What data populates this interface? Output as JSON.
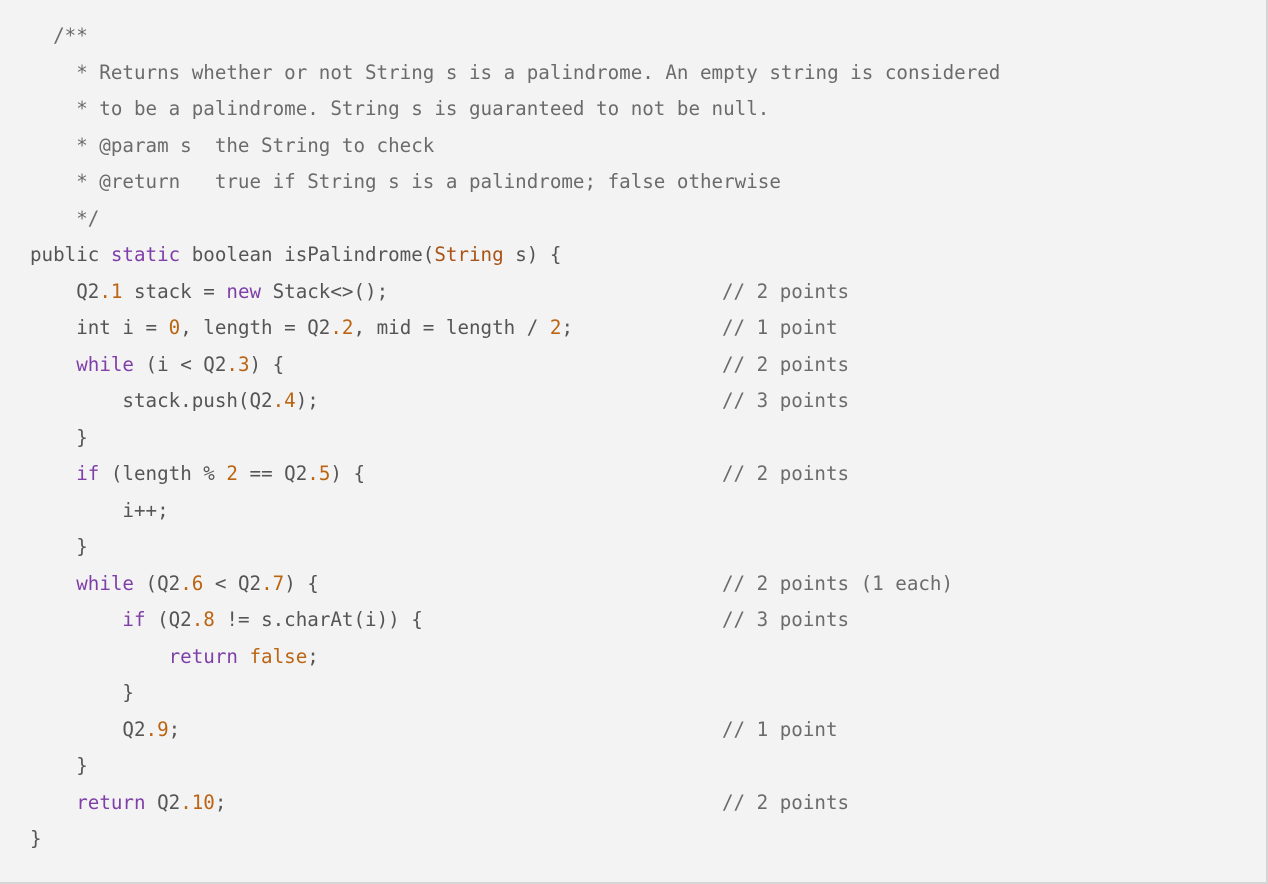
{
  "editor": {
    "language": "java",
    "background_color": "#f3f3f3",
    "border_color": "#d5d5d5",
    "colors": {
      "plain": "#555555",
      "comment": "#6b6b6b",
      "keyword": "#7f3fa8",
      "type": "#a85418",
      "number": "#bb6412",
      "literal": "#bb6412"
    }
  },
  "code": {
    "title": "isPalindrome",
    "lines": [
      {
        "n": 1,
        "indent": 2,
        "text": "/**"
      },
      {
        "n": 2,
        "indent": 4,
        "text": "* Returns whether or not String s is a palindrome. An empty string is considered"
      },
      {
        "n": 3,
        "indent": 4,
        "text": "* to be a palindrome. String s is guaranteed to not be null."
      },
      {
        "n": 4,
        "indent": 4,
        "text": "* @param s  the String to check"
      },
      {
        "n": 5,
        "indent": 4,
        "text": "* @return   true if String s is a palindrome; false otherwise"
      },
      {
        "n": 6,
        "indent": 4,
        "text": "*/"
      },
      {
        "n": 7,
        "indent": 0,
        "text": "public static boolean isPalindrome(String s) {"
      },
      {
        "n": 8,
        "indent": 4,
        "text": "Q2.1 stack = new Stack<>();",
        "comment": "// 2 points"
      },
      {
        "n": 9,
        "indent": 4,
        "text": "int i = 0, length = Q2.2, mid = length / 2;",
        "comment": "// 1 point"
      },
      {
        "n": 10,
        "indent": 4,
        "text": "while (i < Q2.3) {",
        "comment": "// 2 points"
      },
      {
        "n": 11,
        "indent": 8,
        "text": "stack.push(Q2.4);",
        "comment": "// 3 points"
      },
      {
        "n": 12,
        "indent": 4,
        "text": "}"
      },
      {
        "n": 13,
        "indent": 4,
        "text": "if (length % 2 == Q2.5) {",
        "comment": "// 2 points"
      },
      {
        "n": 14,
        "indent": 8,
        "text": "i++;"
      },
      {
        "n": 15,
        "indent": 4,
        "text": "}"
      },
      {
        "n": 16,
        "indent": 4,
        "text": "while (Q2.6 < Q2.7) {",
        "comment": "// 2 points (1 each)"
      },
      {
        "n": 17,
        "indent": 8,
        "text": "if (Q2.8 != s.charAt(i)) {",
        "comment": "// 3 points"
      },
      {
        "n": 18,
        "indent": 12,
        "text": "return false;"
      },
      {
        "n": 19,
        "indent": 8,
        "text": "}"
      },
      {
        "n": 20,
        "indent": 8,
        "text": "Q2.9;",
        "comment": "// 1 point"
      },
      {
        "n": 21,
        "indent": 4,
        "text": "}"
      },
      {
        "n": 22,
        "indent": 4,
        "text": "return Q2.10;",
        "comment": "// 2 points"
      },
      {
        "n": 23,
        "indent": 0,
        "text": "}"
      }
    ],
    "blanks": [
      "Q2.1",
      "Q2.2",
      "Q2.3",
      "Q2.4",
      "Q2.5",
      "Q2.6",
      "Q2.7",
      "Q2.8",
      "Q2.9",
      "Q2.10"
    ],
    "point_values": {
      "Q2.1": "2 points",
      "Q2.2": "1 point",
      "Q2.3": "2 points",
      "Q2.4": "3 points",
      "Q2.5": "2 points",
      "Q2.6_Q2.7": "2 points (1 each)",
      "Q2.8": "3 points",
      "Q2.9": "1 point",
      "Q2.10": "2 points"
    }
  },
  "rendered": {
    "l1": {
      "a": "  /**"
    },
    "l2": {
      "a": "    * Returns whether or not String s is a palindrome. An empty string is considered"
    },
    "l3": {
      "a": "    * to be a palindrome. String s is guaranteed to not be null."
    },
    "l4": {
      "a": "    * @param s  the String to check"
    },
    "l5": {
      "a": "    * @return   true if String s is a palindrome; false otherwise"
    },
    "l6": {
      "a": "    */"
    },
    "l7": {
      "a": "public ",
      "b": "static",
      "c": " boolean isPalindrome(",
      "d": "String",
      "e": " s) {"
    },
    "l8": {
      "a": "    Q2",
      "b": ".1",
      "c": " stack = ",
      "d": "new",
      "e": " Stack<>();",
      "cmt": "// 2 points"
    },
    "l9": {
      "a": "    int i = ",
      "b": "0",
      "c": ", length = Q2",
      "d": ".2",
      "e": ", mid = length / ",
      "f": "2",
      "g": ";",
      "cmt": "// 1 point"
    },
    "l10": {
      "a": "    ",
      "b": "while",
      "c": " (i < Q2",
      "d": ".3",
      "e": ") {",
      "cmt": "// 2 points"
    },
    "l11": {
      "a": "        stack.push(Q2",
      "b": ".4",
      "c": ");",
      "cmt": "// 3 points"
    },
    "l12": {
      "a": "    }"
    },
    "l13": {
      "a": "    ",
      "b": "if",
      "c": " (length % ",
      "d": "2",
      "e": " == Q2",
      "f": ".5",
      "g": ") {",
      "cmt": "// 2 points"
    },
    "l14": {
      "a": "        i++;"
    },
    "l15": {
      "a": "    }"
    },
    "l16": {
      "a": "    ",
      "b": "while",
      "c": " (Q2",
      "d": ".6",
      "e": " < Q2",
      "f": ".7",
      "g": ") {",
      "cmt": "// 2 points (1 each)"
    },
    "l17": {
      "a": "        ",
      "b": "if",
      "c": " (Q2",
      "d": ".8",
      "e": " != s.charAt(i)) {",
      "cmt": "// 3 points"
    },
    "l18": {
      "a": "            ",
      "b": "return",
      "c": " ",
      "d": "false",
      "e": ";"
    },
    "l19": {
      "a": "        }"
    },
    "l20": {
      "a": "        Q2",
      "b": ".9",
      "c": ";",
      "cmt": "// 1 point"
    },
    "l21": {
      "a": "    }"
    },
    "l22": {
      "a": "    ",
      "b": "return",
      "c": " Q2",
      "d": ".10",
      "e": ";",
      "cmt": "// 2 points"
    },
    "l23": {
      "a": "}"
    }
  }
}
